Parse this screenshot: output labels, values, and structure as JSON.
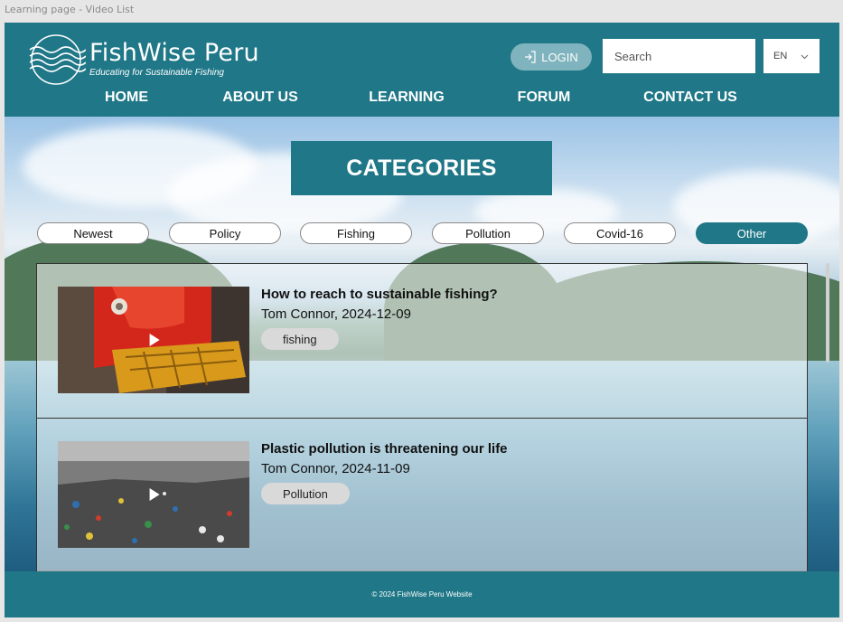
{
  "window": {
    "label": "Learning page - Video List"
  },
  "brand": {
    "name": "FishWise Peru",
    "tagline": "Educating for Sustainable Fishing"
  },
  "header": {
    "login_label": "LOGIN",
    "search_placeholder": "Search",
    "language": "EN"
  },
  "nav": {
    "items": [
      {
        "label": "HOME"
      },
      {
        "label": "ABOUT US"
      },
      {
        "label": "LEARNING"
      },
      {
        "label": "FORUM"
      },
      {
        "label": "CONTACT US"
      }
    ]
  },
  "main": {
    "banner": "CATEGORIES",
    "filters": [
      {
        "label": "Newest",
        "active": false
      },
      {
        "label": "Policy",
        "active": false
      },
      {
        "label": "Fishing",
        "active": false
      },
      {
        "label": "Pollution",
        "active": false
      },
      {
        "label": "Covid-16",
        "active": false
      },
      {
        "label": "Other",
        "active": true
      }
    ],
    "videos": [
      {
        "title": "How to reach to sustainable fishing?",
        "meta": "Tom Connor, 2024-12-09",
        "tag": "fishing"
      },
      {
        "title": "Plastic pollution is threatening our life",
        "meta": "Tom Connor, 2024-11-09",
        "tag": "Pollution"
      }
    ]
  },
  "footer": {
    "text": "© 2024 FishWise Peru Website"
  },
  "colors": {
    "brand": "#1f7787",
    "login": "#7fb3bd",
    "tag": "#d9d9d9"
  }
}
